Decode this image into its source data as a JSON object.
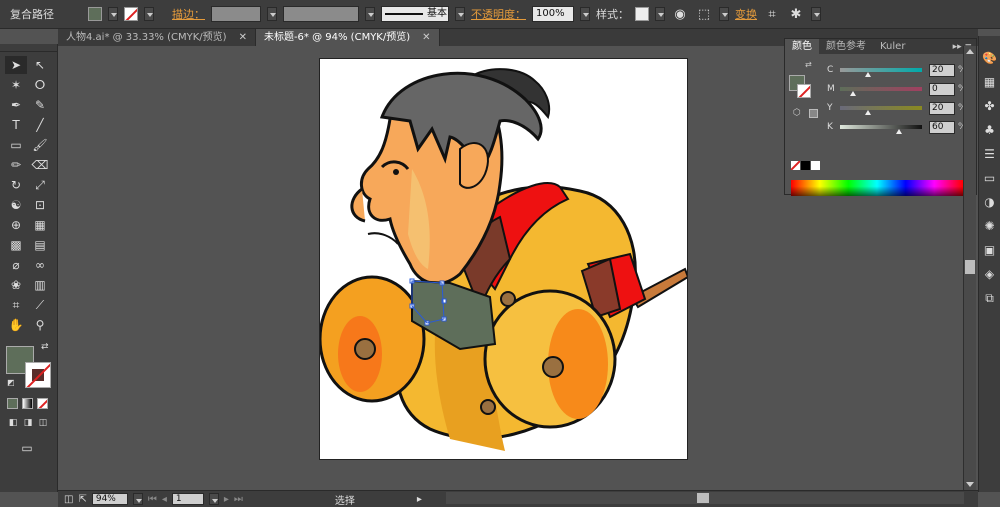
{
  "controlbar": {
    "object_type": "复合路径",
    "stroke_label": "描边：",
    "stroke_style": "基本",
    "opacity_label": "不透明度：",
    "opacity_value": "100%",
    "style_label": "样式：",
    "transform_label": "变换"
  },
  "tabs": [
    {
      "label": "人物4.ai* @ 33.33% (CMYK/预览)"
    },
    {
      "label": "未标题-6* @ 94% (CMYK/预览)"
    }
  ],
  "color_panel": {
    "tabs": [
      "颜色",
      "颜色参考",
      "Kuler"
    ],
    "channels": [
      {
        "letter": "C",
        "value": "20",
        "unit": "%",
        "level": 0.2
      },
      {
        "letter": "M",
        "value": "0",
        "unit": "%",
        "level": 0
      },
      {
        "letter": "Y",
        "value": "20",
        "unit": "%",
        "level": 0.2
      },
      {
        "letter": "K",
        "value": "60",
        "unit": "%",
        "level": 0.6
      }
    ]
  },
  "status": {
    "zoom": "94%",
    "page": "1",
    "tool_name": "选择"
  },
  "colors": {
    "fill": "#5e6e5a",
    "stroke": "#5a2d2a",
    "accent_link": "#e59b3b"
  }
}
